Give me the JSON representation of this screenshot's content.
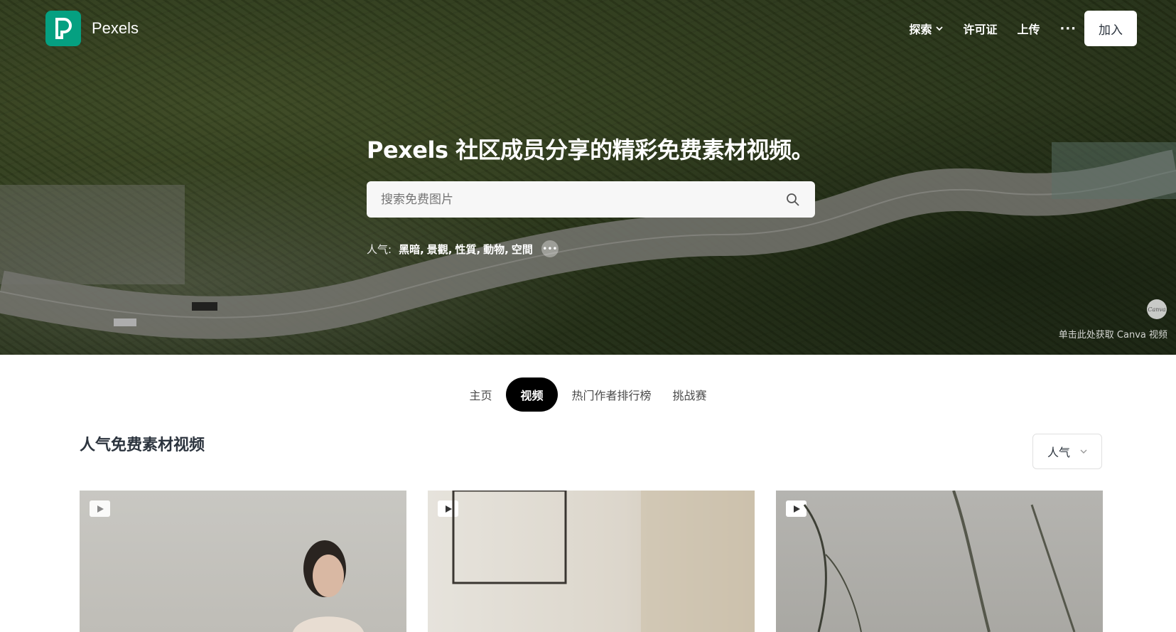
{
  "header": {
    "brand": "Pexels",
    "nav": [
      {
        "label": "探索"
      },
      {
        "label": "许可证"
      },
      {
        "label": "上传"
      }
    ],
    "more": "···",
    "join_label": "加入"
  },
  "hero": {
    "title": "Pexels 社区成员分享的精彩免费素材视频。",
    "search_placeholder": "搜索免费图片",
    "popular_label": "人气:",
    "popular_tags": [
      "黑暗,",
      "景觀,",
      "性質,",
      "動物,",
      "空間"
    ],
    "canva_badge": "Canva",
    "canva_link": "单击此处获取 Canva 视频"
  },
  "tabs": [
    "主页",
    "视频",
    "热门作者排行榜",
    "挑战赛"
  ],
  "section": {
    "title": "人气免费素材视频",
    "sort_label": "人气"
  }
}
